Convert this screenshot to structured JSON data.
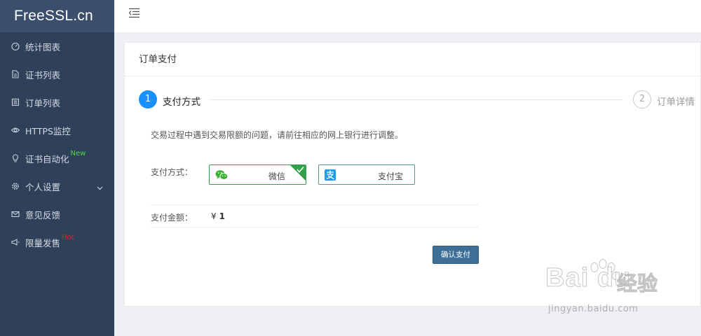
{
  "sidebar": {
    "logo": "FreeSSL.cn",
    "items": [
      {
        "label": "统计图表",
        "icon": "dashboard-icon"
      },
      {
        "label": "证书列表",
        "icon": "file-icon"
      },
      {
        "label": "订单列表",
        "icon": "list-icon"
      },
      {
        "label": "HTTPS监控",
        "icon": "eye-icon"
      },
      {
        "label": "证书自动化",
        "icon": "bulb-icon",
        "badge": "New"
      },
      {
        "label": "个人设置",
        "icon": "gear-icon",
        "expandable": true
      },
      {
        "label": "意见反馈",
        "icon": "mail-icon"
      },
      {
        "label": "限量发售",
        "icon": "megaphone-icon",
        "badge": "Hot"
      }
    ]
  },
  "card": {
    "title": "订单支付",
    "steps": [
      {
        "number": "1",
        "label": "支付方式",
        "state": "active"
      },
      {
        "number": "2",
        "label": "订单详情",
        "state": "pending"
      }
    ],
    "notice": "交易过程中遇到交易限额的问题，请前往相应的网上银行进行调整。",
    "payment_method_label": "支付方式：",
    "payment_options": [
      {
        "label": "微信",
        "icon": "wechat-icon",
        "selected": true
      },
      {
        "label": "支付宝",
        "icon": "alipay-icon",
        "selected": false
      }
    ],
    "amount_label": "支付金额：",
    "currency": "¥",
    "amount": "1",
    "confirm_label": "确认支付"
  },
  "watermark": {
    "brand": "Bai du",
    "brand_cn": "经验",
    "url": "jingyan.baidu.com"
  },
  "colors": {
    "sidebar_bg": "#2f4159",
    "logo_bg": "#3b4e6b",
    "accent_blue": "#1890ff",
    "confirm_bg": "#3d6f97",
    "wechat_green": "#33a14a",
    "new_badge": "#52d84a",
    "hot_badge": "#e0232f"
  }
}
